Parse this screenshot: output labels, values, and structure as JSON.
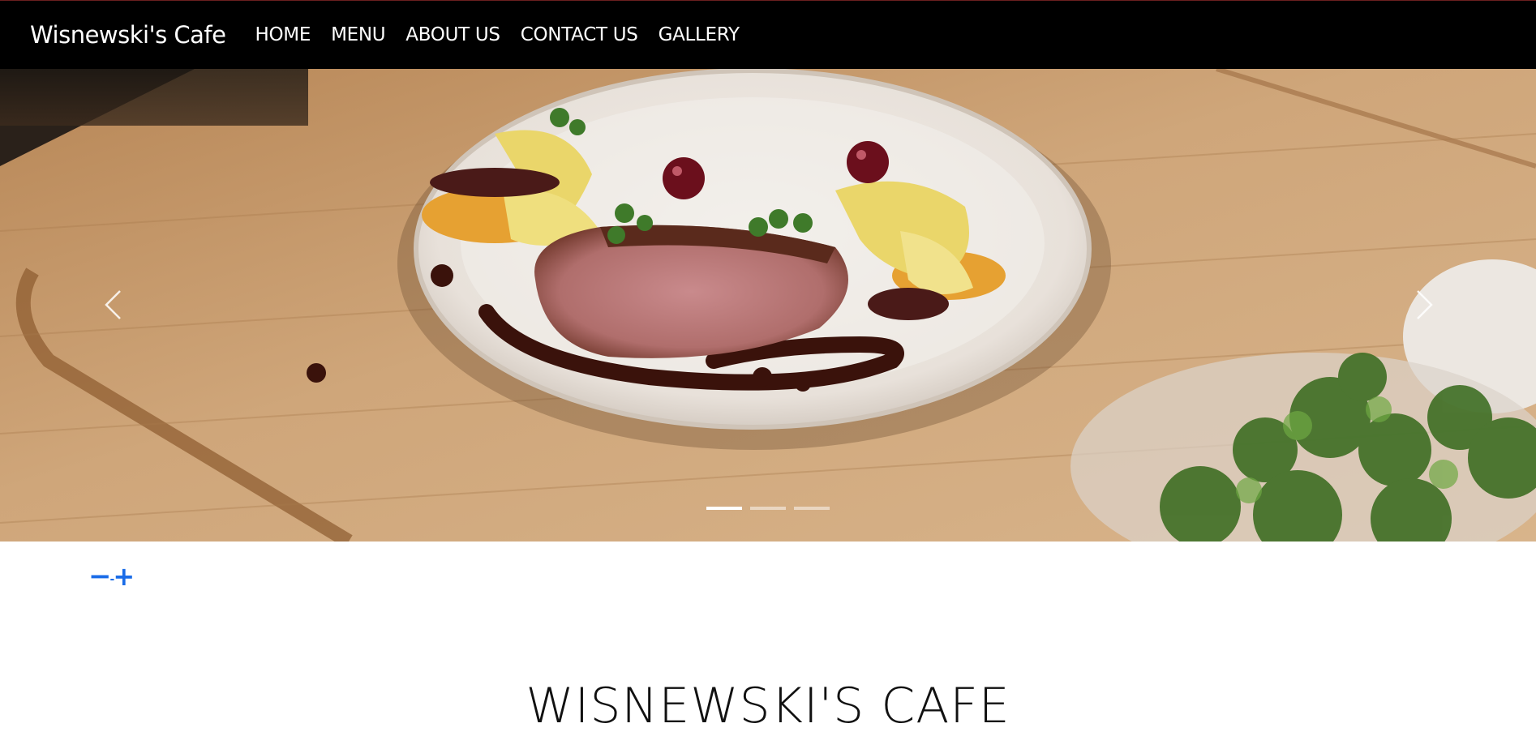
{
  "navbar": {
    "brand": "Wisnewski's Cafe",
    "links": [
      "HOME",
      "MENU",
      "ABOUT US",
      "CONTACT US",
      "GALLERY"
    ]
  },
  "carousel": {
    "slide_count": 3,
    "active_index": 0,
    "image_description": "plated duck breast with cherries and pappardelle on a wooden board"
  },
  "zoom": {
    "minus": "−",
    "dot": "-",
    "plus": "+"
  },
  "main": {
    "heading": "WISNEWSKI'S CAFE"
  },
  "colors": {
    "nav_bg": "#000000",
    "accent": "#1a6ce8"
  }
}
